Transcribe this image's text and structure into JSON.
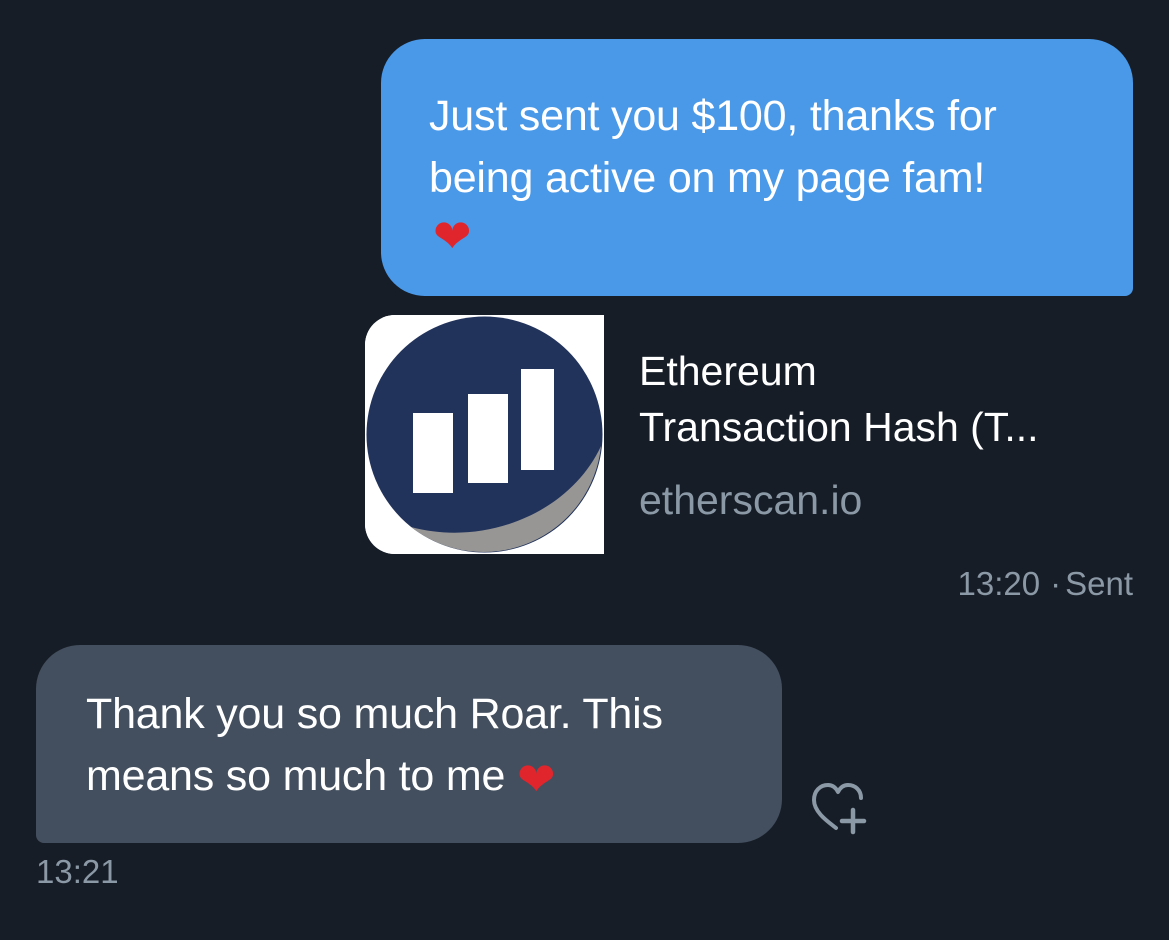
{
  "sent_message": {
    "text": "Just sent you $100, thanks for being active on my page fam!",
    "emoji": "❤"
  },
  "link_preview": {
    "title_line1": "Ethereum",
    "title_line2": "Transaction Hash (T...",
    "domain": "etherscan.io",
    "icon": "etherscan-logo-icon"
  },
  "sent_meta": {
    "time": "13:20",
    "separator": "·",
    "status": "Sent"
  },
  "received_message": {
    "text": "Thank you so much Roar. This means so much to me",
    "emoji": "❤",
    "time": "13:21"
  },
  "reaction_button": {
    "icon": "heart-plus-icon"
  },
  "colors": {
    "background": "#161d27",
    "sent_bubble": "#4a99e9",
    "received_bubble": "#434f5e",
    "meta_text": "#8b98a5",
    "logo_navy": "#21325b",
    "logo_gray": "#979695"
  }
}
